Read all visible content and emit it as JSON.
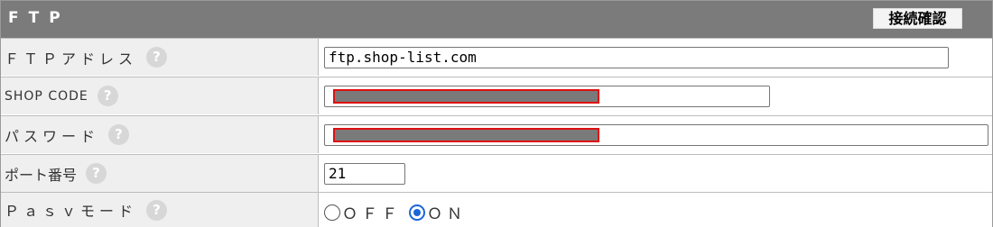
{
  "header": {
    "title": "FTP",
    "connect_button": "接続確認"
  },
  "help_icon_glyph": "?",
  "rows": [
    {
      "label": "ＦＴＰアドレス",
      "value": "ftp.shop-list.com"
    },
    {
      "label": "SHOP CODE",
      "value": ""
    },
    {
      "label": "パスワード",
      "value": ""
    },
    {
      "label": "ポート番号",
      "value": "21"
    },
    {
      "label": "Ｐａｓｖモード",
      "options": [
        {
          "label": "ＯＦＦ",
          "checked": false
        },
        {
          "label": "ＯＮ",
          "checked": true
        }
      ]
    }
  ],
  "colors": {
    "header_bg": "#7b7b7b",
    "label_bg": "#efefef",
    "redaction_border": "#e01010",
    "radio_accent": "#1a66d6"
  },
  "icons": {
    "help": "question-circle-icon"
  }
}
